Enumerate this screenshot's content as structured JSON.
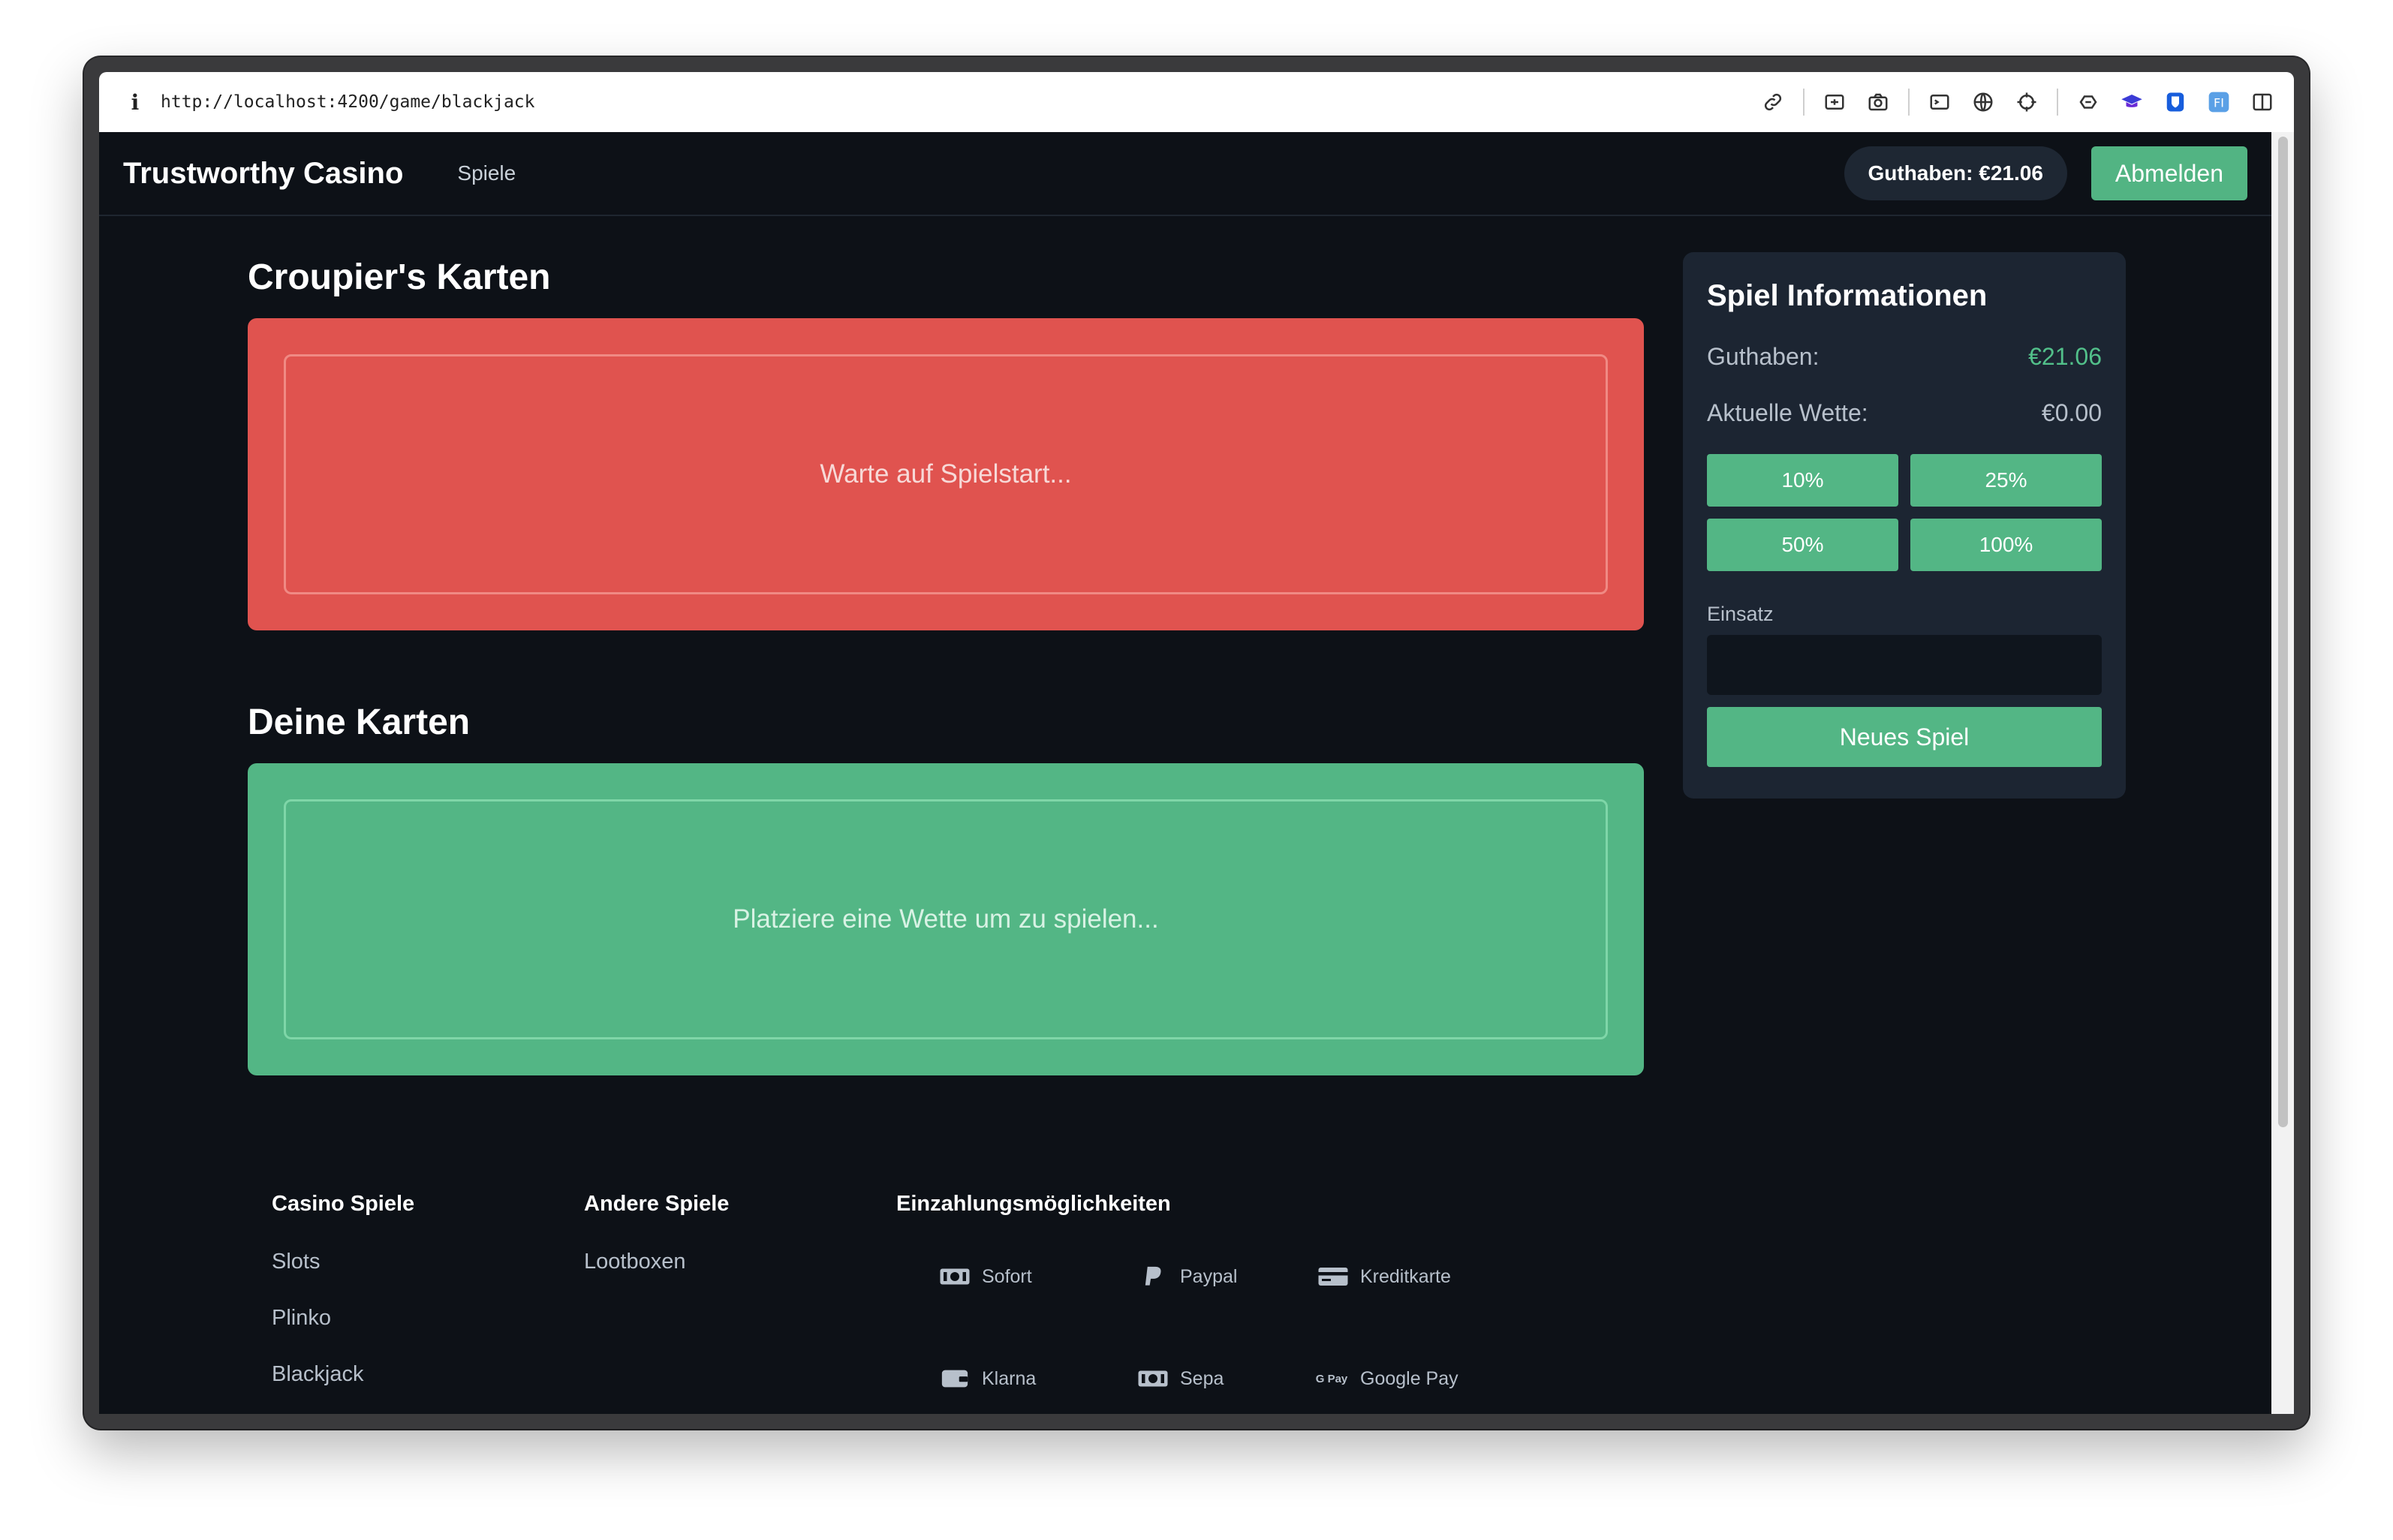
{
  "browser": {
    "url": "http://localhost:4200/game/blackjack",
    "toolbar_icons": [
      "link-icon",
      "screen-capture-icon",
      "camera-icon",
      "terminal-icon",
      "globe-icon",
      "crosshair-icon",
      "extension-icon",
      "graduation-cap-icon",
      "bitwarden-icon",
      "fi-icon",
      "sidebar-icon"
    ]
  },
  "nav": {
    "brand": "Trustworthy Casino",
    "games_link": "Spiele",
    "balance": "Guthaben: €21.06",
    "logout": "Abmelden"
  },
  "dealer": {
    "title": "Croupier's Karten",
    "placeholder": "Warte auf Spielstart..."
  },
  "player": {
    "title": "Deine Karten",
    "placeholder": "Platziere eine Wette um zu spielen..."
  },
  "info_panel": {
    "title": "Spiel Informationen",
    "balance_label": "Guthaben:",
    "balance_value": "€21.06",
    "bet_label": "Aktuelle Wette:",
    "bet_value": "€0.00",
    "percent_buttons": [
      "10%",
      "25%",
      "50%",
      "100%"
    ],
    "stake_label": "Einsatz",
    "stake_value": "",
    "new_game": "Neues Spiel"
  },
  "footer": {
    "casino_games": {
      "heading": "Casino Spiele",
      "links": [
        "Slots",
        "Plinko",
        "Blackjack"
      ]
    },
    "other_games": {
      "heading": "Andere Spiele",
      "links": [
        "Lootboxen"
      ]
    },
    "payments": {
      "heading": "Einzahlungsmöglichkeiten",
      "methods": [
        {
          "label": "Sofort",
          "icon": "money-icon"
        },
        {
          "label": "Paypal",
          "icon": "paypal-icon"
        },
        {
          "label": "Kreditkarte",
          "icon": "credit-card-icon"
        },
        {
          "label": "Klarna",
          "icon": "wallet-icon"
        },
        {
          "label": "Sepa",
          "icon": "money-icon"
        },
        {
          "label": "Google Pay",
          "icon": "google-pay-icon",
          "icon_text": "G Pay"
        }
      ]
    }
  },
  "colors": {
    "background": "#0d1117",
    "accent_green": "#53b685",
    "dealer_red": "#e0534f",
    "panel": "#1c2532"
  }
}
